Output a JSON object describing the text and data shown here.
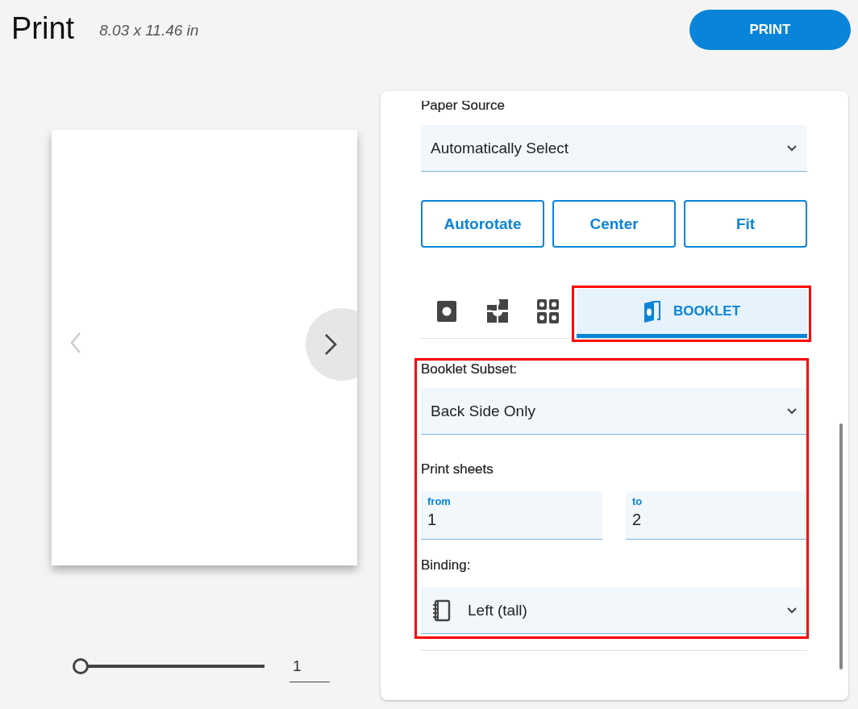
{
  "title": "Print",
  "paper_size": "8.03 x 11.46 in",
  "print_button": "PRINT",
  "preview": {
    "previous_disabled": true,
    "page_slider": {
      "level": 0
    },
    "page_number": "1"
  },
  "settings": {
    "paper_source": {
      "label": "Paper Source",
      "value": "Automatically Select"
    },
    "align_buttons": [
      "Autorotate",
      "Center",
      "Fit"
    ],
    "layout_tabs": [
      {
        "kind": "single",
        "selected": false,
        "highlighted": false
      },
      {
        "kind": "quarters",
        "selected": false,
        "highlighted": false
      },
      {
        "kind": "grid",
        "selected": false,
        "highlighted": false
      },
      {
        "kind": "booklet",
        "label": "BOOKLET",
        "selected": true,
        "highlighted": true
      }
    ],
    "booklet": {
      "highlighted": true,
      "subset": {
        "label": "Booklet Subset:",
        "value": "Back Side Only"
      },
      "print_sheets": {
        "label": "Print sheets",
        "from": {
          "label": "from",
          "value": "1"
        },
        "to": {
          "label": "to",
          "value": "2"
        }
      },
      "binding": {
        "label": "Binding:",
        "value": "Left (tall)"
      }
    }
  }
}
